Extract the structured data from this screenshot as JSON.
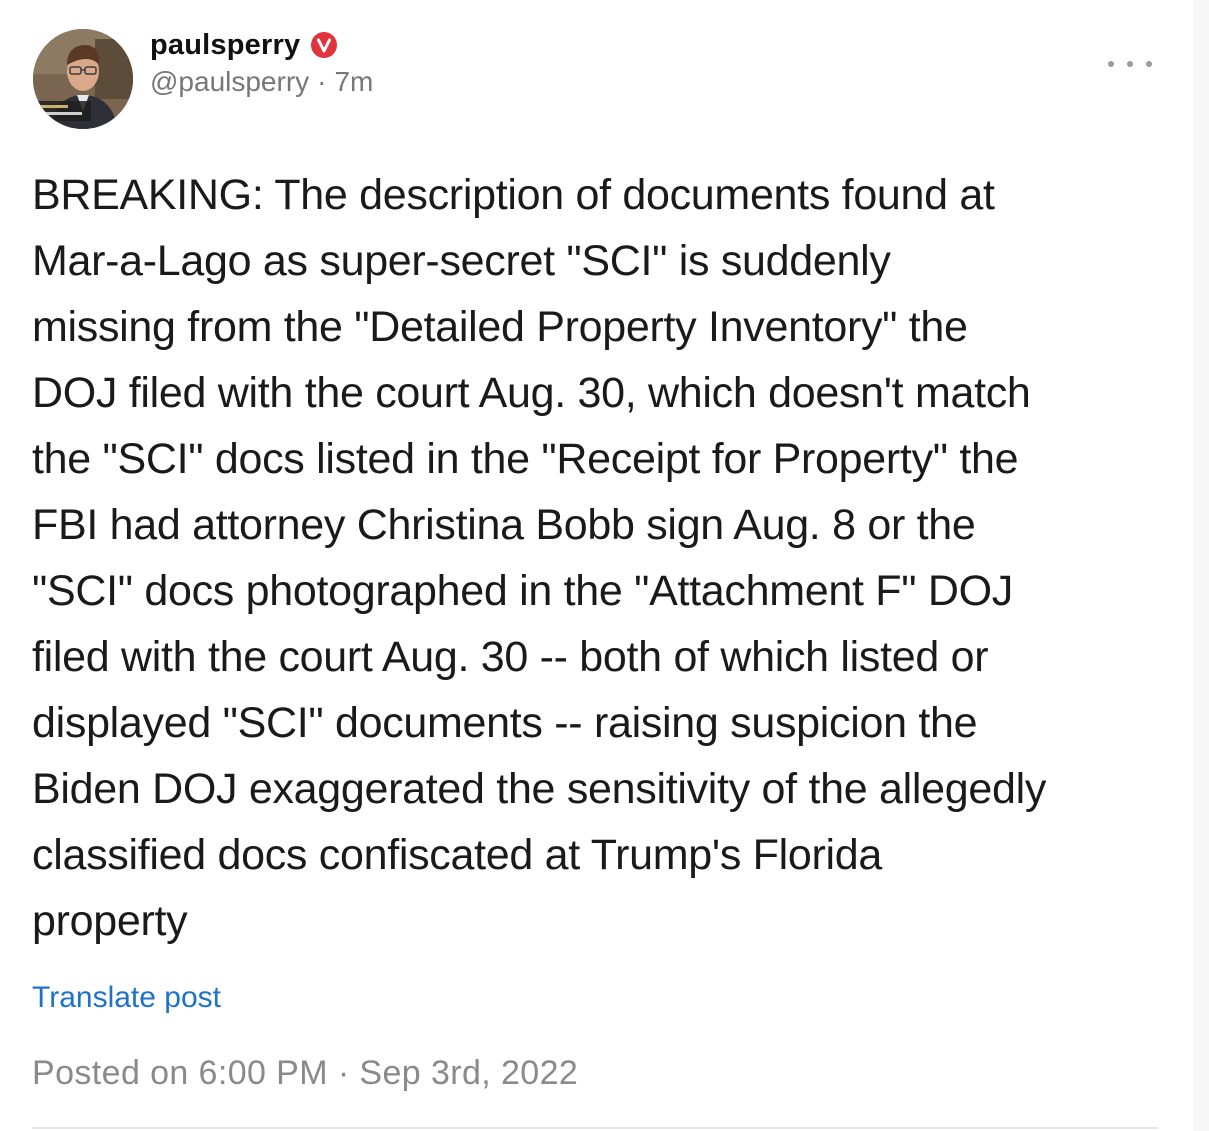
{
  "author": {
    "display_name": "paulsperry",
    "handle": "@paulsperry",
    "separator": "·",
    "time_ago": "7m",
    "verified": true,
    "verified_color": "#e0333e"
  },
  "post": {
    "text": "BREAKING: The description of documents found at\nMar-a-Lago as super-secret \"SCI\" is suddenly\nmissing from the \"Detailed Property Inventory\" the\nDOJ filed with the court Aug. 30, which doesn't match\nthe \"SCI\" docs listed in the \"Receipt for Property\" the\nFBI had attorney Christina Bobb sign Aug. 8 or the\n\"SCI\" docs photographed in the \"Attachment F\" DOJ\nfiled with the court Aug. 30 -- both of which listed or\ndisplayed \"SCI\" documents -- raising suspicion the\nBiden DOJ exaggerated the sensitivity of the allegedly\nclassified docs confiscated at Trump's Florida\nproperty",
    "translate_label": "Translate post",
    "posted_meta": "Posted on 6:00 PM · Sep 3rd, 2022"
  },
  "icons": {
    "avatar": "profile-photo",
    "badge": "verified-check-icon",
    "more": "ellipsis-icon"
  },
  "colors": {
    "link": "#1d73c9",
    "meta": "#8a8a8a",
    "text": "#1a1a1a"
  }
}
